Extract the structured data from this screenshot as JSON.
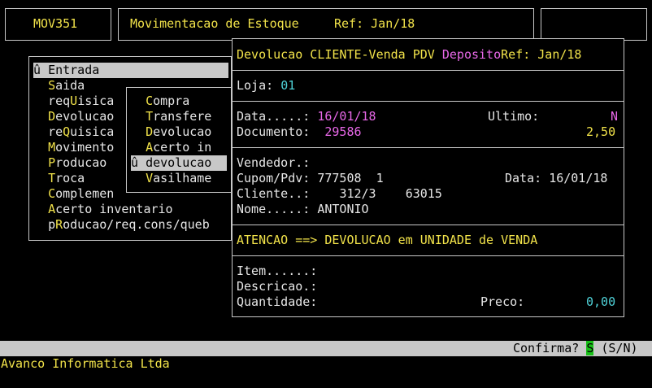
{
  "header": {
    "program_code": "MOV351",
    "title": "Movimentacao de Estoque",
    "ref": "Ref: Jan/18"
  },
  "main_menu": {
    "items": [
      {
        "prefix": "û ",
        "hot": "",
        "rest": "Entrada",
        "selected": true
      },
      {
        "prefix": "  ",
        "hot": "S",
        "rest": "aida"
      },
      {
        "prefix": "  ",
        "hot": "",
        "pre": "req",
        "hotmid": "U",
        "rest": "isica"
      },
      {
        "prefix": "  ",
        "hot": "D",
        "rest": "evolucao"
      },
      {
        "prefix": "  ",
        "hot": "",
        "pre": "re",
        "hotmid": "Q",
        "rest": "uisica"
      },
      {
        "prefix": "  ",
        "hot": "M",
        "rest": "ovimento"
      },
      {
        "prefix": "  ",
        "hot": "P",
        "rest": "roducao"
      },
      {
        "prefix": "  ",
        "hot": "T",
        "rest": "roca"
      },
      {
        "prefix": "  ",
        "hot": "C",
        "rest": "omplemen"
      },
      {
        "prefix": "  ",
        "hot": "A",
        "rest": "certo inventario"
      },
      {
        "prefix": "  ",
        "hot": "",
        "pre": "p",
        "hotmid": "R",
        "rest": "oducao/req.cons/queb"
      }
    ]
  },
  "sub_menu": {
    "items": [
      {
        "prefix": "  ",
        "hot": "C",
        "rest": "ompra"
      },
      {
        "prefix": "  ",
        "hot": "T",
        "rest": "ransfere"
      },
      {
        "prefix": "  ",
        "hot": "D",
        "rest": "evolucao"
      },
      {
        "prefix": "  ",
        "hot": "A",
        "rest": "certo in"
      },
      {
        "prefix": "û ",
        "hot": "",
        "rest": "devolucao",
        "selected": true
      },
      {
        "prefix": "  ",
        "hot": "V",
        "rest": "asilhame"
      }
    ]
  },
  "dialog": {
    "title_main": "Devolucao CLIENTE-Venda PDV ",
    "title_deposit": "Deposito",
    "title_ref": "Ref: Jan/18",
    "loja_label": "Loja:",
    "loja_value": "01",
    "data_label": "Data.....:",
    "data_value": "16/01/18",
    "ultimo_label": "Ultimo:",
    "ultimo_value": "N",
    "documento_label": "Documento:",
    "documento_value": "29586",
    "documento_amount": "2,50",
    "vendedor_label": "Vendedor.:",
    "cupom_label": "Cupom/Pdv:",
    "cupom_value": "777508  1",
    "cupom_data_label": "Data:",
    "cupom_data_value": "16/01/18",
    "cliente_label": "Cliente..:",
    "cliente_value": "312/3    63015",
    "nome_label": "Nome.....:",
    "nome_value": "ANTONIO",
    "alert": "ATENCAO ==> DEVOLUCAO em UNIDADE de VENDA",
    "item_label": "Item......:",
    "descricao_label": "Descricao.:",
    "quantidade_label": "Quantidade:",
    "preco_label": "Preco:",
    "preco_value": "0,00"
  },
  "status": {
    "confirm_label": "Confirma?",
    "confirm_value": "S",
    "confirm_options": "(S/N)"
  },
  "footer": {
    "company": "Avanco Informatica Ltda"
  }
}
